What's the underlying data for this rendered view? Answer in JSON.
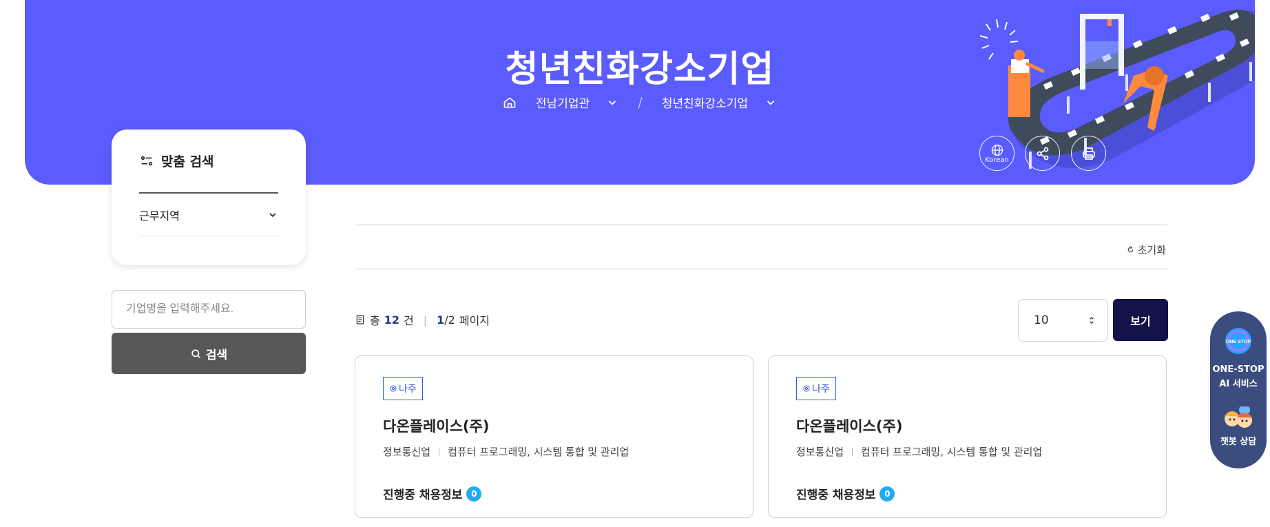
{
  "header": {
    "title": "청년친화강소기업",
    "breadcrumb": [
      "전남기업관",
      "청년친화강소기업"
    ],
    "lang_label": "Korean"
  },
  "filter": {
    "title": "맞춤 검색",
    "row_label": "근무지역"
  },
  "search": {
    "placeholder": "기업명을 입력해주세요.",
    "button_label": "검색"
  },
  "reset_label": "초기화",
  "result": {
    "total_prefix": "총",
    "total": "12",
    "total_suffix": "건",
    "page_current": "1",
    "page_total": "/2",
    "page_suffix": "페이지"
  },
  "pagesize": {
    "value": "10",
    "button_label": "보기"
  },
  "cards": [
    {
      "region": "나주",
      "name": "다온플레이스(주)",
      "industry": "정보통신업",
      "detail": "컴퓨터 프로그래밍, 시스템 통합 및 관리업",
      "jobs_label": "진행중 채용정보",
      "jobs_count": "0"
    },
    {
      "region": "나주",
      "name": "다온플레이스(주)",
      "industry": "정보통신업",
      "detail": "컴퓨터 프로그래밍, 시스템 통합 및 관리업",
      "jobs_label": "진행중 채용정보",
      "jobs_count": "0"
    }
  ],
  "side_widget": {
    "logo_text": "ONE STOP",
    "service_line1": "ONE-STOP",
    "service_line2": "AI 서비스",
    "chat_label": "챗봇 상담"
  },
  "colors": {
    "hero_bg": "#5b5cfd",
    "view_button": "#131249",
    "search_button": "#575757",
    "tag": "#3b5bdb",
    "badge": "#22aaf0",
    "widget_bg": "#3a4d7e"
  }
}
